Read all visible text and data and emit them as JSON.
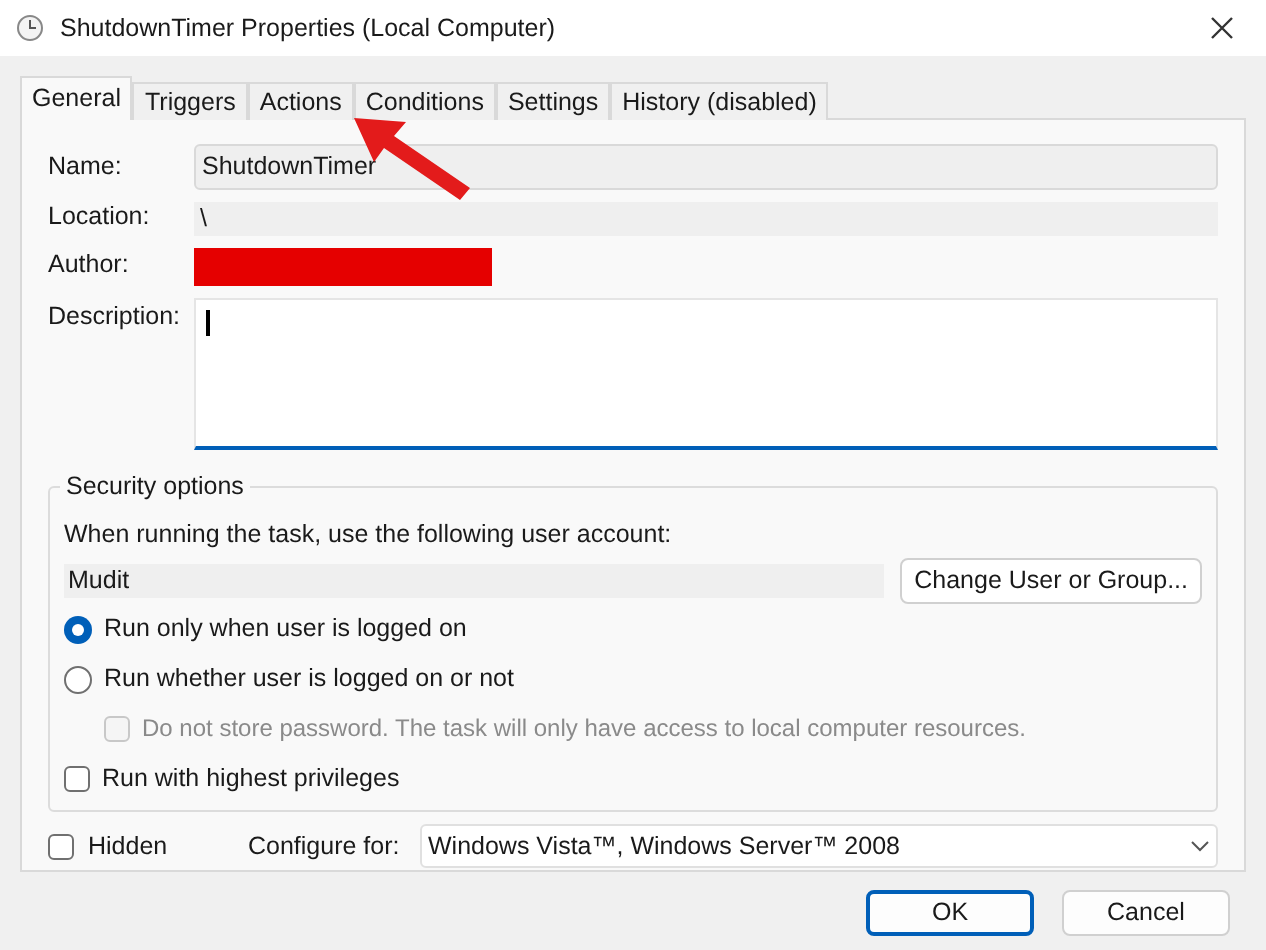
{
  "window": {
    "title": "ShutdownTimer Properties (Local Computer)"
  },
  "tabs": [
    {
      "label": "General",
      "selected": true
    },
    {
      "label": "Triggers",
      "selected": false
    },
    {
      "label": "Actions",
      "selected": false
    },
    {
      "label": "Conditions",
      "selected": false
    },
    {
      "label": "Settings",
      "selected": false
    },
    {
      "label": "History (disabled)",
      "selected": false
    }
  ],
  "fields": [
    {
      "label": "Name:",
      "value": "ShutdownTimer",
      "kind": "input"
    },
    {
      "label": "Location:",
      "value": "\\",
      "kind": "readonly"
    },
    {
      "label": "Author:",
      "kind": "redacted"
    },
    {
      "label": "Description:",
      "kind": "textarea"
    }
  ],
  "security": {
    "title": "Security options",
    "prompt": "When running the task, use the following user account:",
    "account": "Mudit",
    "change_button": "Change User or Group...",
    "options": [
      {
        "kind": "radio",
        "label": "Run only when user is logged on",
        "selected": true
      },
      {
        "kind": "radio",
        "label": "Run whether user is logged on or not",
        "selected": false
      },
      {
        "kind": "checkbox",
        "label": "Do not store password.  The task will only have access to local computer resources.",
        "checked": false,
        "disabled": true
      },
      {
        "kind": "checkbox",
        "label": "Run with highest privileges",
        "checked": false,
        "disabled": false
      }
    ]
  },
  "hidden": {
    "label": "Hidden",
    "checked": false
  },
  "configure": {
    "label": "Configure for:",
    "value": "Windows Vista™, Windows Server™ 2008"
  },
  "buttons": [
    {
      "label": "OK",
      "kind": "default"
    },
    {
      "label": "Cancel",
      "kind": "normal"
    }
  ]
}
